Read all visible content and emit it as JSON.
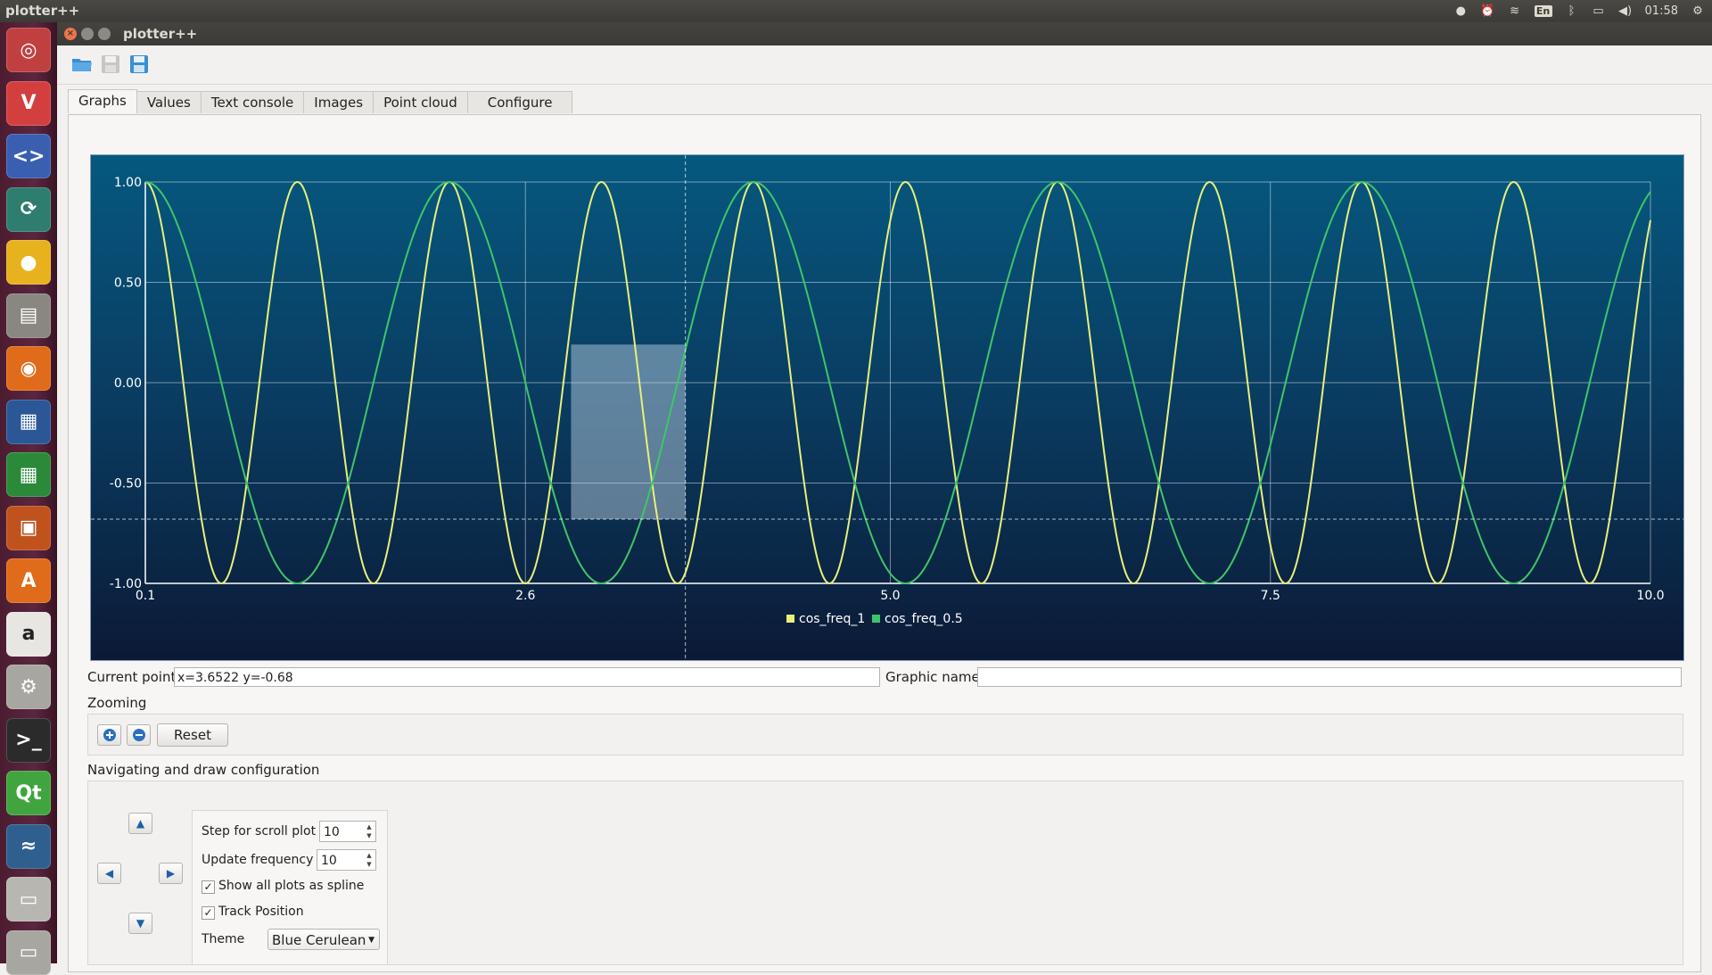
{
  "topbar": {
    "app_title": "plotter++",
    "keyboard_layout": "En",
    "clock": "01:58"
  },
  "launcher": {
    "items": [
      {
        "icon": "dash-home-icon",
        "glyph": "◎",
        "color": "#c04040"
      },
      {
        "icon": "vivaldi-icon",
        "glyph": "V",
        "color": "#d33f3f"
      },
      {
        "icon": "code-editor-icon",
        "glyph": "<>",
        "color": "#3a5fb0"
      },
      {
        "icon": "network-icon",
        "glyph": "⟳",
        "color": "#2e7d6e"
      },
      {
        "icon": "chrome-icon",
        "glyph": "●",
        "color": "#e8b21e"
      },
      {
        "icon": "files-icon",
        "glyph": "▤",
        "color": "#8a8780"
      },
      {
        "icon": "firefox-icon",
        "glyph": "◉",
        "color": "#e06b1b"
      },
      {
        "icon": "writer-icon",
        "glyph": "▦",
        "color": "#2b5797"
      },
      {
        "icon": "calc-icon",
        "glyph": "▦",
        "color": "#2a8a3a"
      },
      {
        "icon": "impress-icon",
        "glyph": "▣",
        "color": "#c0521e"
      },
      {
        "icon": "software-center-icon",
        "glyph": "A",
        "color": "#e06b1b"
      },
      {
        "icon": "amazon-icon",
        "glyph": "a",
        "color": "#e8e6e2"
      },
      {
        "icon": "system-settings-icon",
        "glyph": "⚙",
        "color": "#a8a6a0"
      },
      {
        "icon": "terminal-icon",
        "glyph": ">_",
        "color": "#2b2b2b"
      },
      {
        "icon": "qt-creator-icon",
        "glyph": "Qt",
        "color": "#41a53f"
      },
      {
        "icon": "plotter-icon",
        "glyph": "≈",
        "color": "#2f5f8f"
      },
      {
        "icon": "drive-icon",
        "glyph": "▭",
        "color": "#b8b6b0"
      },
      {
        "icon": "scanner-icon",
        "glyph": "▭",
        "color": "#a8a6a0"
      }
    ]
  },
  "window": {
    "title": "plotter++",
    "toolbar": {
      "open_icon": "folder-open-icon",
      "save_icon": "save-icon",
      "save_as_icon": "save-as-icon"
    },
    "tabs": [
      {
        "label": "Graphs",
        "active": true
      },
      {
        "label": "Values",
        "active": false
      },
      {
        "label": "Text console",
        "active": false
      },
      {
        "label": "Images",
        "active": false
      },
      {
        "label": "Point cloud",
        "active": false
      },
      {
        "label": "Configure",
        "active": false
      }
    ]
  },
  "chart_data": {
    "type": "line",
    "xlim": [
      0.1,
      10.0
    ],
    "ylim": [
      -1.0,
      1.0
    ],
    "xticks": [
      "0.1",
      "2.6",
      "5.0",
      "7.5",
      "10.0"
    ],
    "xtick_values": [
      0.1,
      2.6,
      5.0,
      7.5,
      10.0
    ],
    "yticks": [
      "1.00",
      "0.50",
      "0.00",
      "-0.50",
      "-1.00"
    ],
    "ytick_values": [
      1.0,
      0.5,
      0.0,
      -0.5,
      -1.0
    ],
    "grid": true,
    "legend_placement": "bottom-center",
    "series": [
      {
        "name": "cos_freq_1",
        "color": "#e8f07a",
        "period_x": 1.0,
        "phase_x": 0.1,
        "amplitude": 1.0
      },
      {
        "name": "cos_freq_0.5",
        "color": "#3fc56a",
        "period_x": 2.0,
        "phase_x": 0.1,
        "amplitude": 1.0
      }
    ],
    "crosshair": {
      "x": 3.6522,
      "y": -0.68
    },
    "selection": {
      "x_from": 2.9,
      "x_to": 3.6522,
      "y_from": -0.68,
      "y_to": 0.19
    },
    "background_colors": {
      "top": "#06587f",
      "bottom": "#0b1a36"
    }
  },
  "current_point": {
    "label": "Current point",
    "value": "x=3.6522 y=-0.68"
  },
  "graphic_name": {
    "label": "Graphic name",
    "value": ""
  },
  "zooming": {
    "title": "Zooming",
    "zoom_in_icon": "zoom-in-icon",
    "zoom_out_icon": "zoom-out-icon",
    "reset_label": "Reset"
  },
  "navigation": {
    "title": "Navigating and draw configuration",
    "step_label": "Step for scroll plot",
    "step_value": "10",
    "update_label": "Update frequency",
    "update_value": "10",
    "spline_label": "Show all plots as spline",
    "spline_checked": true,
    "track_label": "Track  Position",
    "track_checked": true,
    "theme_label": "Theme",
    "theme_value": "Blue Cerulean"
  }
}
